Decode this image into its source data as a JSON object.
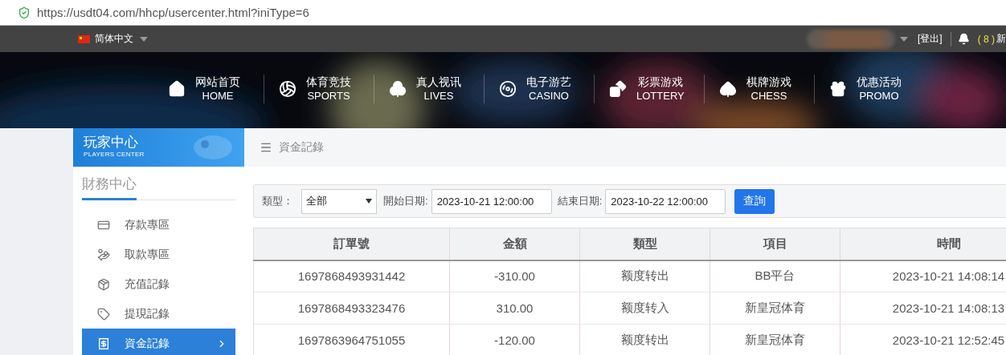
{
  "address_bar": {
    "url": "https://usdt04.com/hhcp/usercenter.html?iniType=6"
  },
  "top_bar": {
    "language": "简体中文",
    "logout": "[登出]",
    "notifications": "( 8 )",
    "notifications_label": "新"
  },
  "nav": [
    {
      "title": "网站首页",
      "subtitle": "HOME"
    },
    {
      "title": "体育竞技",
      "subtitle": "SPORTS"
    },
    {
      "title": "真人视讯",
      "subtitle": "LIVES"
    },
    {
      "title": "电子游艺",
      "subtitle": "CASINO"
    },
    {
      "title": "彩票游戏",
      "subtitle": "LOTTERY"
    },
    {
      "title": "棋牌游戏",
      "subtitle": "CHESS"
    },
    {
      "title": "优惠活动",
      "subtitle": "PROMO"
    }
  ],
  "sidebar": {
    "title": "玩家中心",
    "subtitle": "PLAYERS CENTER",
    "section": "財務中心",
    "items": [
      {
        "label": "存款專區",
        "selected": false
      },
      {
        "label": "取款專區",
        "selected": false
      },
      {
        "label": "充值記錄",
        "selected": false
      },
      {
        "label": "提現記錄",
        "selected": false
      },
      {
        "label": "資金記錄",
        "selected": true
      }
    ]
  },
  "page": {
    "title": "資金記錄"
  },
  "filter": {
    "type_label": "類型：",
    "type_value": "全部",
    "start_label": "開始日期:",
    "start_value": "2023-10-21 12:00:00",
    "end_label": "結束日期:",
    "end_value": "2023-10-22 12:00:00",
    "button": "查詢"
  },
  "table": {
    "columns": [
      "訂單號",
      "金額",
      "類型",
      "項目",
      "時間"
    ],
    "rows": [
      [
        "1697868493931442",
        "-310.00",
        "额度转出",
        "BB平台",
        "2023-10-21 14:08:14"
      ],
      [
        "1697868493323476",
        "310.00",
        "额度转入",
        "新皇冠体育",
        "2023-10-21 14:08:13"
      ],
      [
        "1697863964751055",
        "-120.00",
        "额度转出",
        "新皇冠体育",
        "2023-10-21 12:52:45"
      ]
    ]
  }
}
